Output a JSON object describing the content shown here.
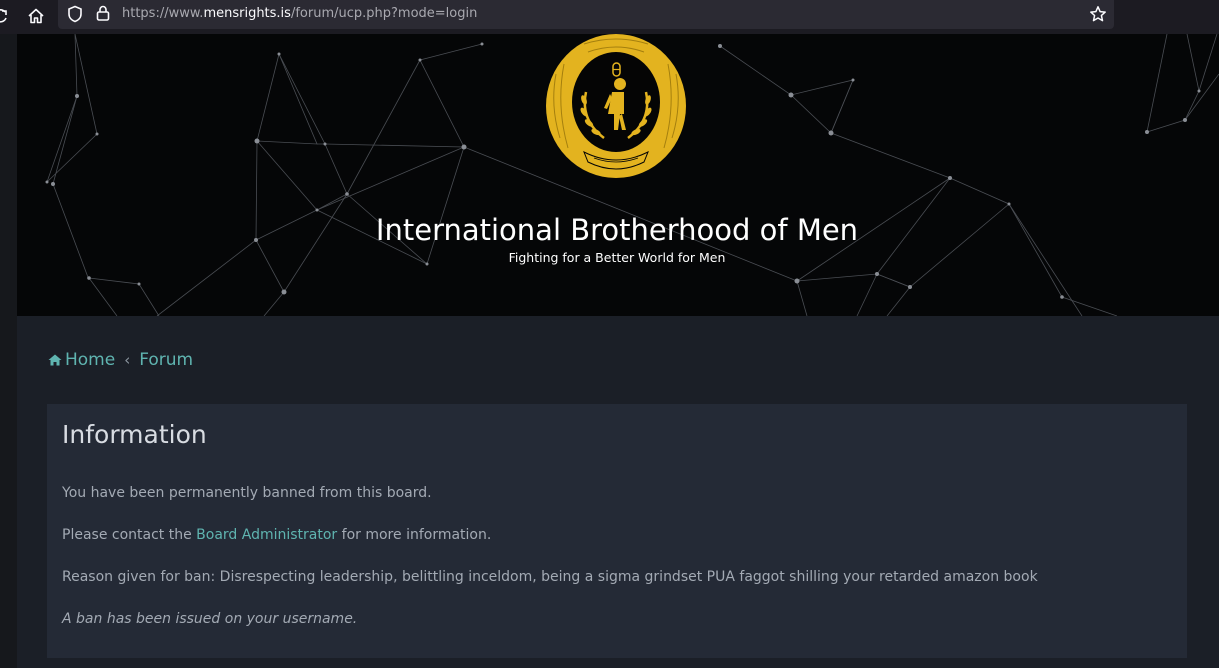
{
  "browser": {
    "url_prefix": "https://www.",
    "url_host": "mensrights.is",
    "url_path": "/forum/ucp.php?mode=login",
    "icons": [
      "reload-icon",
      "home-icon",
      "shield-icon",
      "lock-icon",
      "star-icon"
    ]
  },
  "header": {
    "title": "International Brotherhood of Men",
    "subtitle": "Fighting for a Better World for Men",
    "emblem_icon": "wreath-emblem-icon"
  },
  "breadcrumbs": {
    "home": "Home",
    "separator": "‹",
    "forum": "Forum"
  },
  "panel": {
    "title": "Information",
    "line1": "You have been permanently banned from this board.",
    "line2_pre": "Please contact the ",
    "line2_link": "Board Administrator",
    "line2_post": " for more information.",
    "line3": "Reason given for ban: Disrespecting leadership, belittling inceldom, being a sigma grindset PUA faggot shilling your retarded amazon book",
    "line4": "A ban has been issued on your username."
  },
  "colors": {
    "link": "#5fb4b0",
    "panel_bg": "#242a36",
    "page_bg": "#1b1f27",
    "banner_bg": "#050607",
    "emblem_gold": "#e3b31f"
  }
}
